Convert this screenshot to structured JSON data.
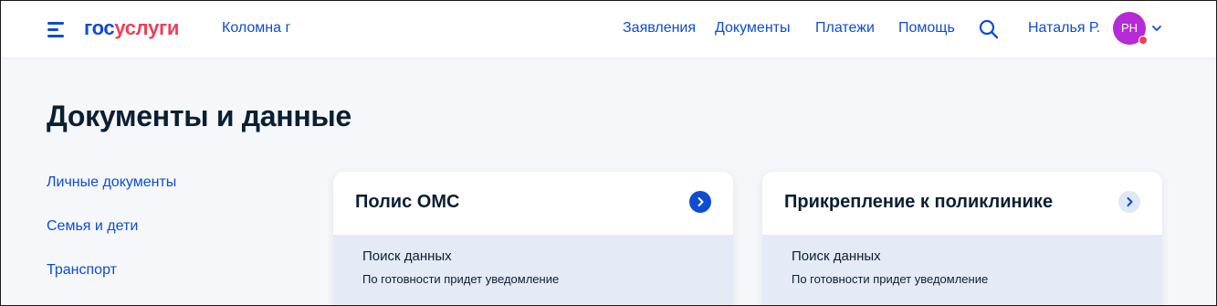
{
  "header": {
    "logo_part1": "гос",
    "logo_part2": "услуги",
    "city": "Коломна г",
    "nav": [
      "Заявления",
      "Документы",
      "Платежи",
      "Помощь"
    ],
    "username": "Наталья Р.",
    "avatar_initials": "РН"
  },
  "page": {
    "title": "Документы и данные"
  },
  "sidebar": {
    "items": [
      "Личные документы",
      "Семья и дети",
      "Транспорт"
    ]
  },
  "cards": [
    {
      "title": "Полис ОМС",
      "status_title": "Поиск данных",
      "status_sub": "По готовности придет уведомление"
    },
    {
      "title": "Прикрепление к поликлинике",
      "status_title": "Поиск данных",
      "status_sub": "По готовности придет уведомление"
    }
  ],
  "colors": {
    "brand_blue": "#0d4cd3",
    "brand_red": "#ee3f58",
    "avatar_bg": "#b52bd6",
    "status_bg": "#e4ebf6",
    "page_bg": "#f5f7fa"
  },
  "icons": [
    "menu-icon",
    "search-icon",
    "chevron-down-icon",
    "arrow-right-icon"
  ]
}
